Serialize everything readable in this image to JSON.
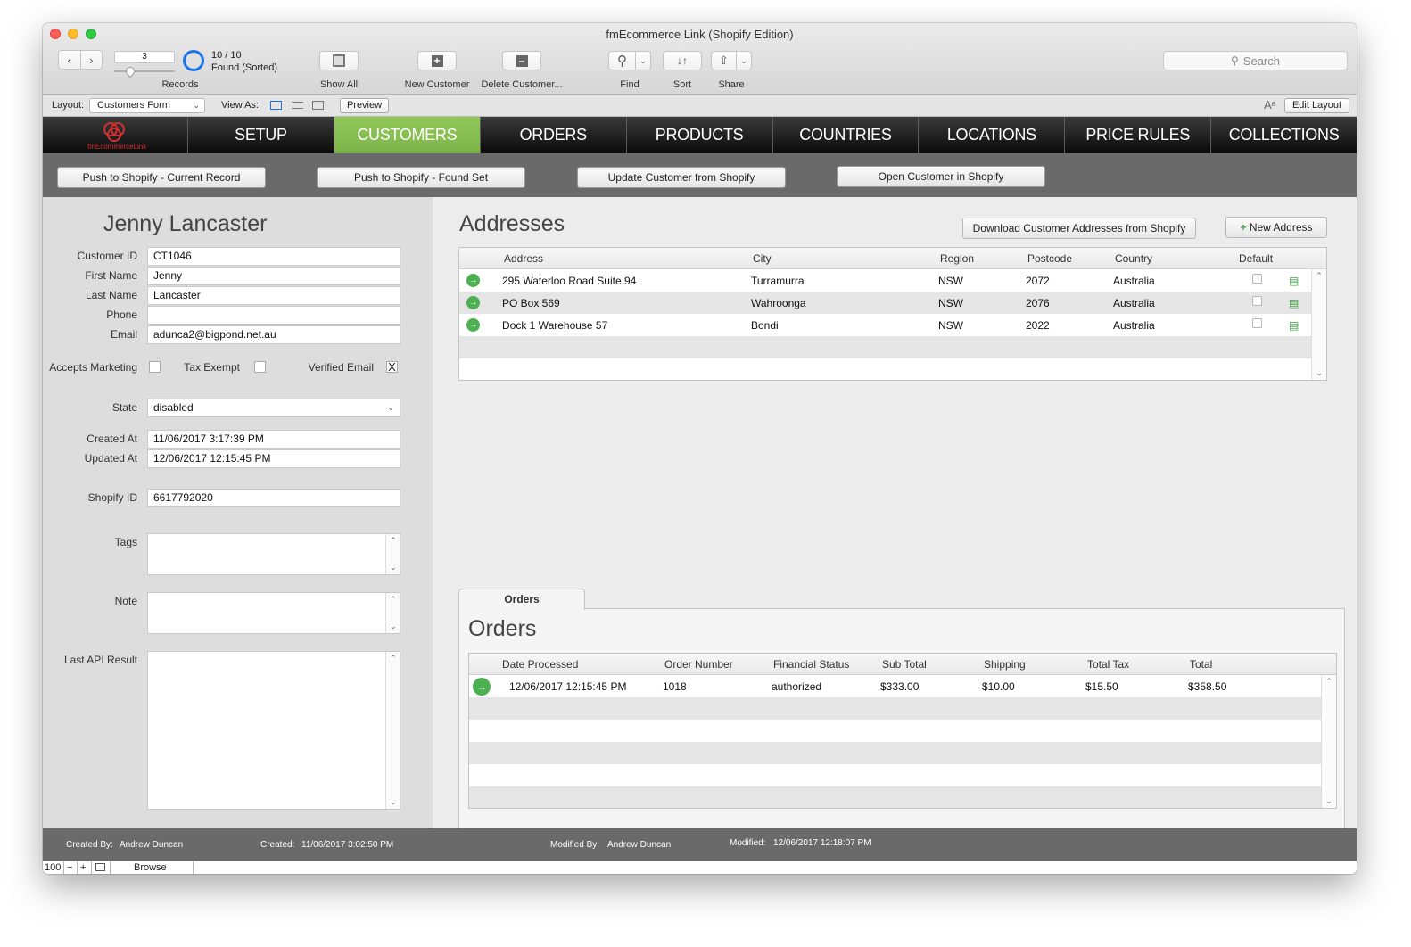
{
  "window": {
    "title": "fmEcommerce Link (Shopify Edition)"
  },
  "toolbar": {
    "record_number": "3",
    "records_label": "Records",
    "found_count": "10 / 10",
    "found_status": "Found (Sorted)",
    "show_all": "Show All",
    "new_customer": "New Customer",
    "delete_customer": "Delete Customer...",
    "find": "Find",
    "sort": "Sort",
    "share": "Share",
    "search_placeholder": "Search"
  },
  "layoutbar": {
    "layout_label": "Layout:",
    "layout_value": "Customers Form",
    "view_as_label": "View As:",
    "preview": "Preview",
    "edit_layout": "Edit Layout"
  },
  "nav": {
    "logo_text": "fmEcommerceLink",
    "tabs": [
      "SETUP",
      "CUSTOMERS",
      "ORDERS",
      "PRODUCTS",
      "COUNTRIES",
      "LOCATIONS",
      "PRICE RULES",
      "COLLECTIONS"
    ],
    "active_tab": "CUSTOMERS"
  },
  "actions": {
    "push_current": "Push to Shopify - Current Record",
    "push_found": "Push to Shopify - Found Set",
    "update_customer": "Update Customer from Shopify",
    "open_customer": "Open Customer in Shopify"
  },
  "customer": {
    "name": "Jenny Lancaster",
    "labels": {
      "customer_id": "Customer ID",
      "first_name": "First Name",
      "last_name": "Last Name",
      "phone": "Phone",
      "email": "Email",
      "accepts_marketing": "Accepts Marketing",
      "tax_exempt": "Tax Exempt",
      "verified_email": "Verified Email",
      "state": "State",
      "created_at": "Created At",
      "updated_at": "Updated At",
      "shopify_id": "Shopify ID",
      "tags": "Tags",
      "note": "Note",
      "last_api_result": "Last API Result"
    },
    "customer_id": "CT1046",
    "first_name": "Jenny",
    "last_name": "Lancaster",
    "phone": "",
    "email": "adunca2@bigpond.net.au",
    "accepts_marketing": false,
    "tax_exempt": false,
    "verified_email": true,
    "verified_mark": "X",
    "state": "disabled",
    "created_at": "11/06/2017 3:17:39 PM",
    "updated_at": "12/06/2017 12:15:45 PM",
    "shopify_id": "6617792020",
    "tags": "",
    "note": "",
    "last_api_result": ""
  },
  "addresses": {
    "title": "Addresses",
    "download_button": "Download Customer Addresses from Shopify",
    "new_address_button": "New Address",
    "columns": [
      "Address",
      "City",
      "Region",
      "Postcode",
      "Country",
      "Default"
    ],
    "rows": [
      {
        "address": "295 Waterloo Road Suite 94",
        "city": "Turramurra",
        "region": "NSW",
        "postcode": "2072",
        "country": "Australia",
        "default": false
      },
      {
        "address": "PO Box 569",
        "city": "Wahroonga",
        "region": "NSW",
        "postcode": "2076",
        "country": "Australia",
        "default": false
      },
      {
        "address": "Dock 1 Warehouse 57",
        "city": "Bondi",
        "region": "NSW",
        "postcode": "2022",
        "country": "Australia",
        "default": false
      }
    ]
  },
  "orders": {
    "tab_label": "Orders",
    "title": "Orders",
    "columns": [
      "Date Processed",
      "Order Number",
      "Financial Status",
      "Sub Total",
      "Shipping",
      "Total Tax",
      "Total"
    ],
    "rows": [
      {
        "date": "12/06/2017 12:15:45 PM",
        "order_number": "1018",
        "financial_status": "authorized",
        "sub_total": "$333.00",
        "shipping": "$10.00",
        "total_tax": "$15.50",
        "total": "$358.50"
      }
    ]
  },
  "footer": {
    "created_by_label": "Created By:",
    "created_by": "Andrew Duncan",
    "created_label": "Created:",
    "created": "11/06/2017 3:02:50 PM",
    "modified_by_label": "Modified By:",
    "modified_by": "Andrew Duncan",
    "modified_label": "Modified:",
    "modified": "12/06/2017 12:18:07 PM"
  },
  "statusbar": {
    "zoom": "100",
    "mode": "Browse"
  },
  "colors": {
    "active_tab": "#8bc34a",
    "accent_blue": "#1a73e8",
    "go_green": "#4caf50"
  }
}
